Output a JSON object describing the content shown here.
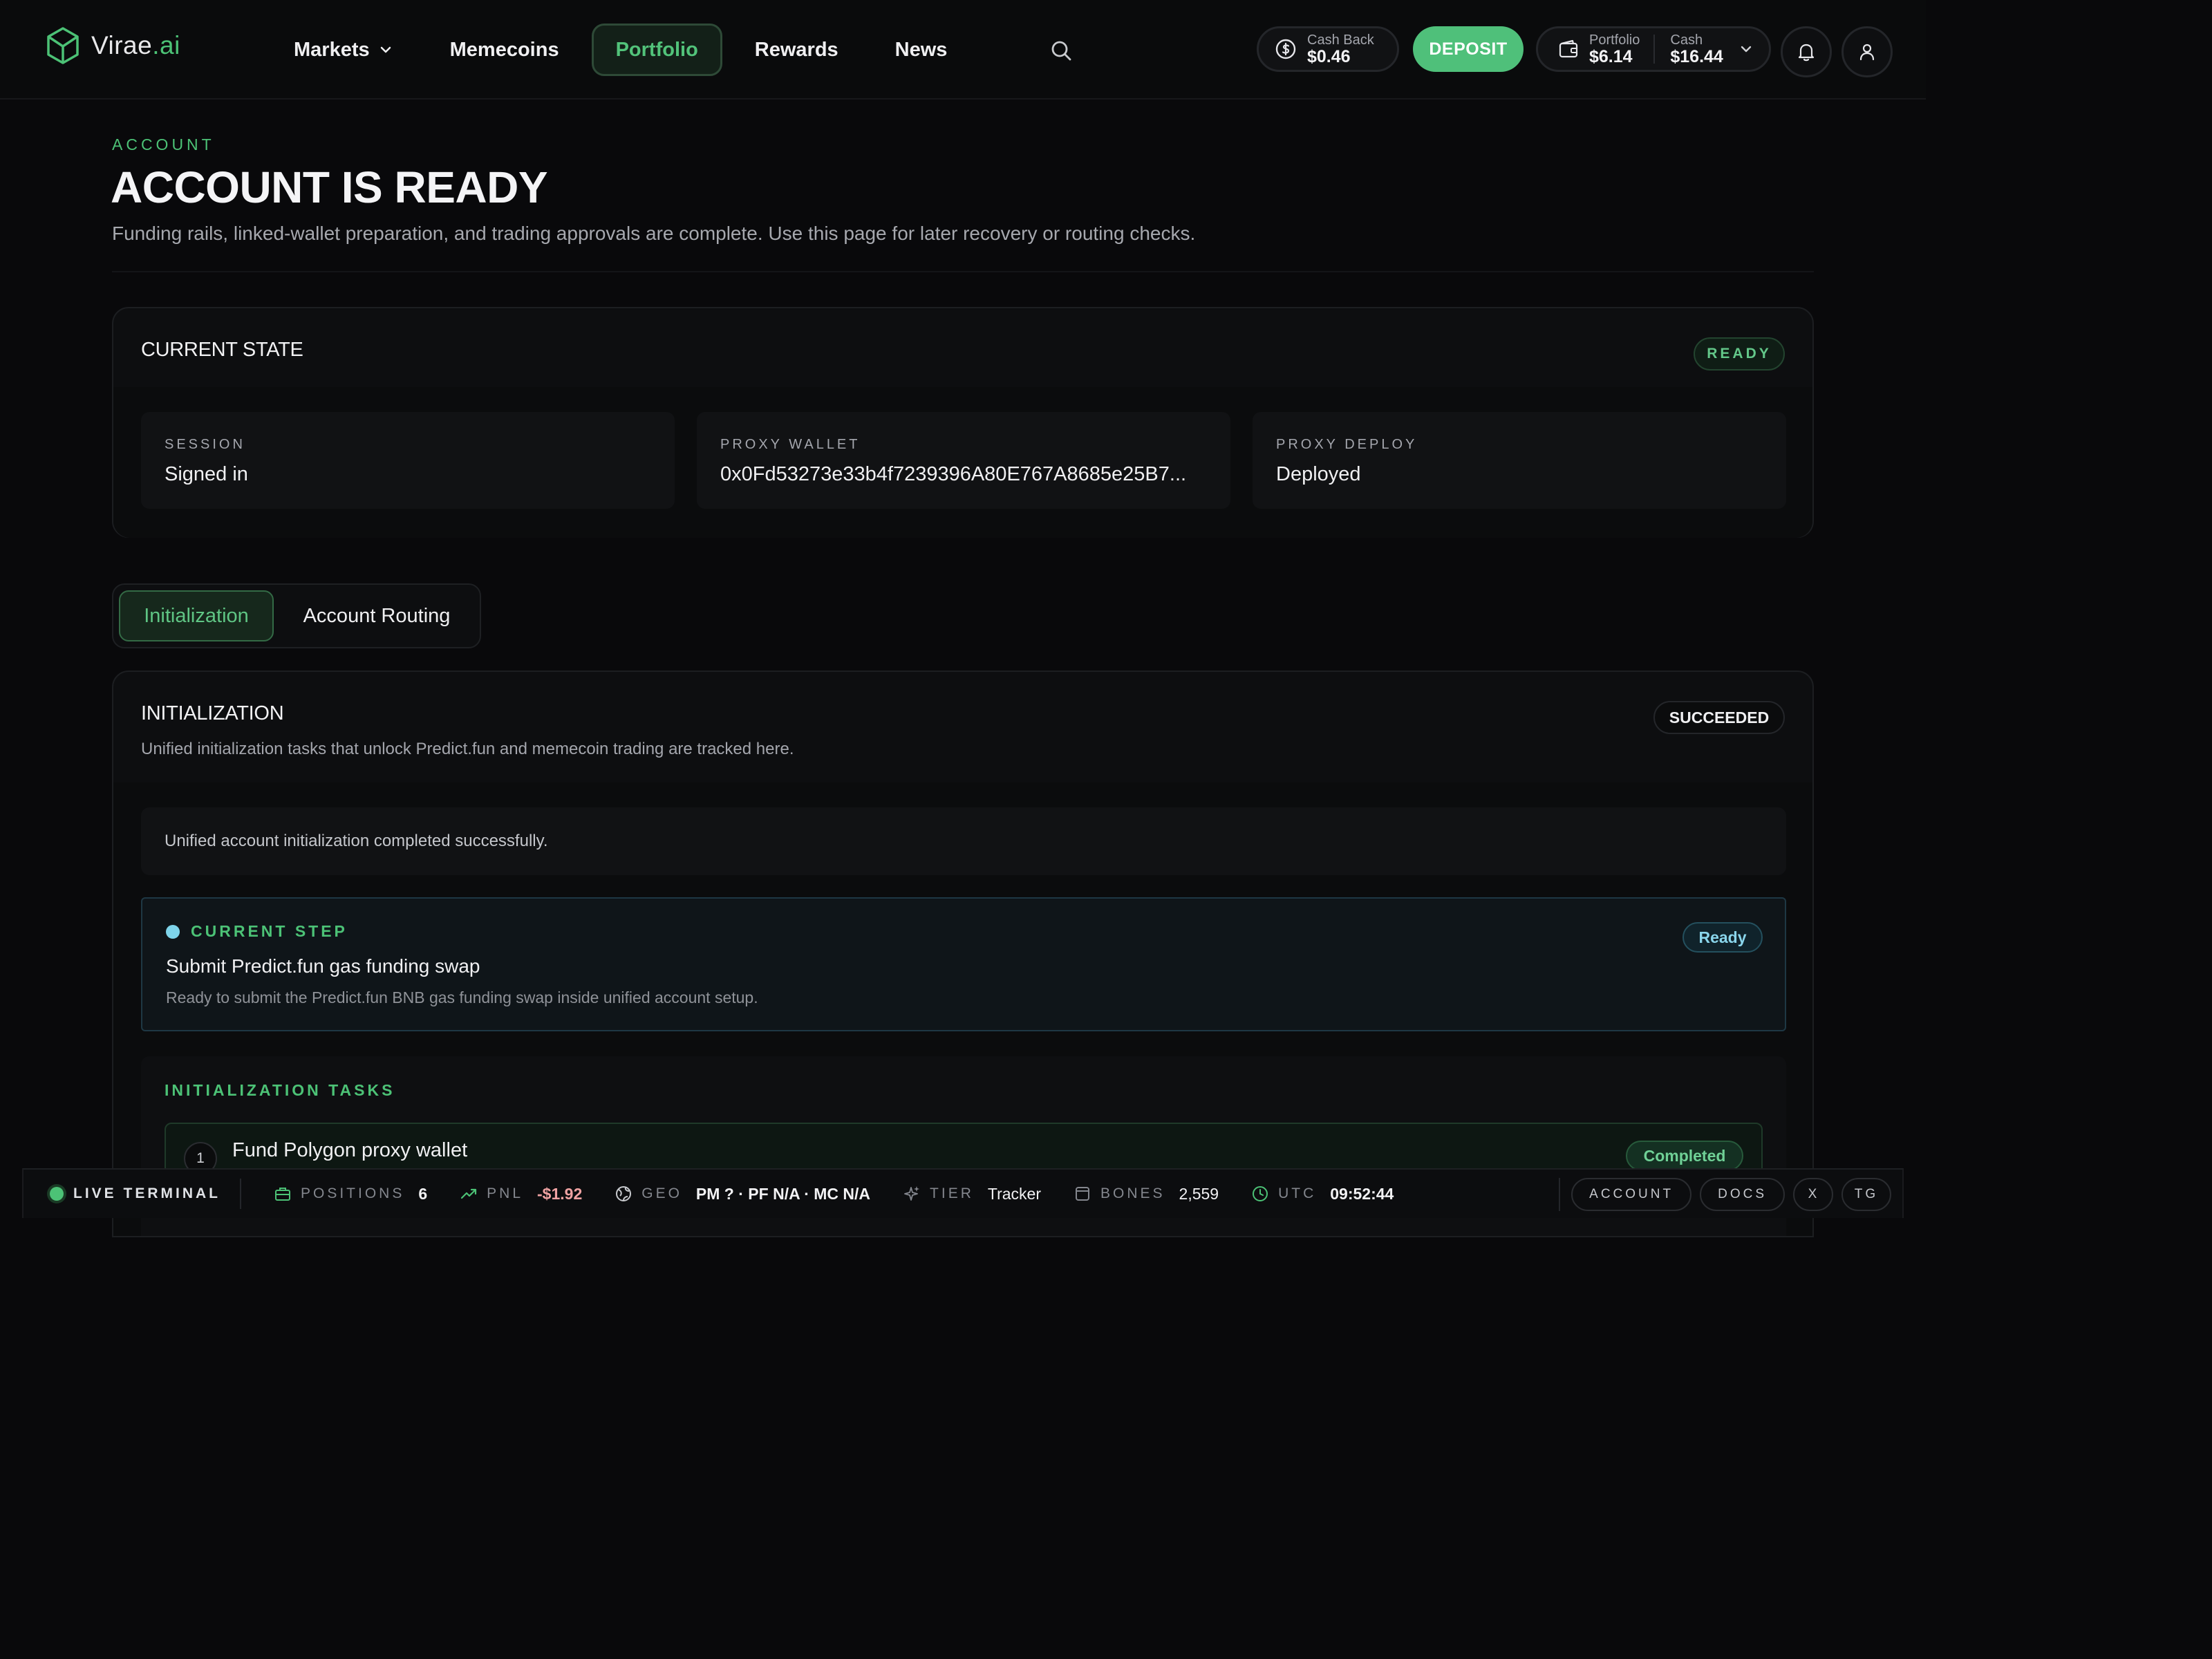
{
  "brand": {
    "name": "Virae",
    "suffix": ".ai",
    "accent": "#4cc276"
  },
  "nav": {
    "items": [
      {
        "label": "Markets",
        "has_dropdown": true
      },
      {
        "label": "Memecoins"
      },
      {
        "label": "Portfolio",
        "active": true
      },
      {
        "label": "Rewards"
      },
      {
        "label": "News"
      }
    ],
    "search_icon": "search-icon"
  },
  "header_actions": {
    "cashback": {
      "label": "Cash Back",
      "value": "$0.46",
      "icon": "dollar-circle-icon"
    },
    "deposit_label": "DEPOSIT",
    "portfolio": {
      "label": "Portfolio",
      "value": "$6.14"
    },
    "cash": {
      "label": "Cash",
      "value": "$16.44"
    },
    "bell_icon": "bell-icon",
    "user_icon": "user-icon"
  },
  "page": {
    "eyebrow": "ACCOUNT",
    "title": "ACCOUNT IS READY",
    "description": "Funding rails, linked-wallet preparation, and trading approvals are complete. Use this page for later recovery or routing checks."
  },
  "current_state": {
    "title": "CURRENT STATE",
    "badge": "READY",
    "fields": [
      {
        "label": "SESSION",
        "value": "Signed in"
      },
      {
        "label": "PROXY WALLET",
        "value": "0x0Fd53273e33b4f7239396A80E767A8685e25B7..."
      },
      {
        "label": "PROXY DEPLOY",
        "value": "Deployed"
      }
    ]
  },
  "tabs": [
    {
      "label": "Initialization",
      "active": true
    },
    {
      "label": "Account Routing"
    }
  ],
  "initialization": {
    "title": "INITIALIZATION",
    "badge": "SUCCEEDED",
    "subtitle": "Unified initialization tasks that unlock Predict.fun and memecoin trading are tracked here.",
    "message": "Unified account initialization completed successfully.",
    "current_step": {
      "eyebrow": "CURRENT STEP",
      "title": "Submit Predict.fun gas funding swap",
      "description": "Ready to submit the Predict.fun BNB gas funding swap inside unified account setup.",
      "badge": "Ready"
    },
    "tasks_title": "INITIALIZATION TASKS",
    "tasks": [
      {
        "number": "1",
        "title": "Fund Polygon proxy wallet",
        "status": "Completed"
      }
    ]
  },
  "status_bar": {
    "live_label": "LIVE TERMINAL",
    "positions": {
      "label": "POSITIONS",
      "value": "6"
    },
    "pnl": {
      "label": "PNL",
      "value": "-$1.92"
    },
    "geo": {
      "label": "GEO",
      "value": "PM ? · PF N/A · MC N/A"
    },
    "tier": {
      "label": "TIER",
      "value": "Tracker"
    },
    "bones": {
      "label": "BONES",
      "value": "2,559"
    },
    "utc": {
      "label": "UTC",
      "value": "09:52:44"
    },
    "links": [
      "ACCOUNT",
      "DOCS",
      "X",
      "TG"
    ]
  }
}
